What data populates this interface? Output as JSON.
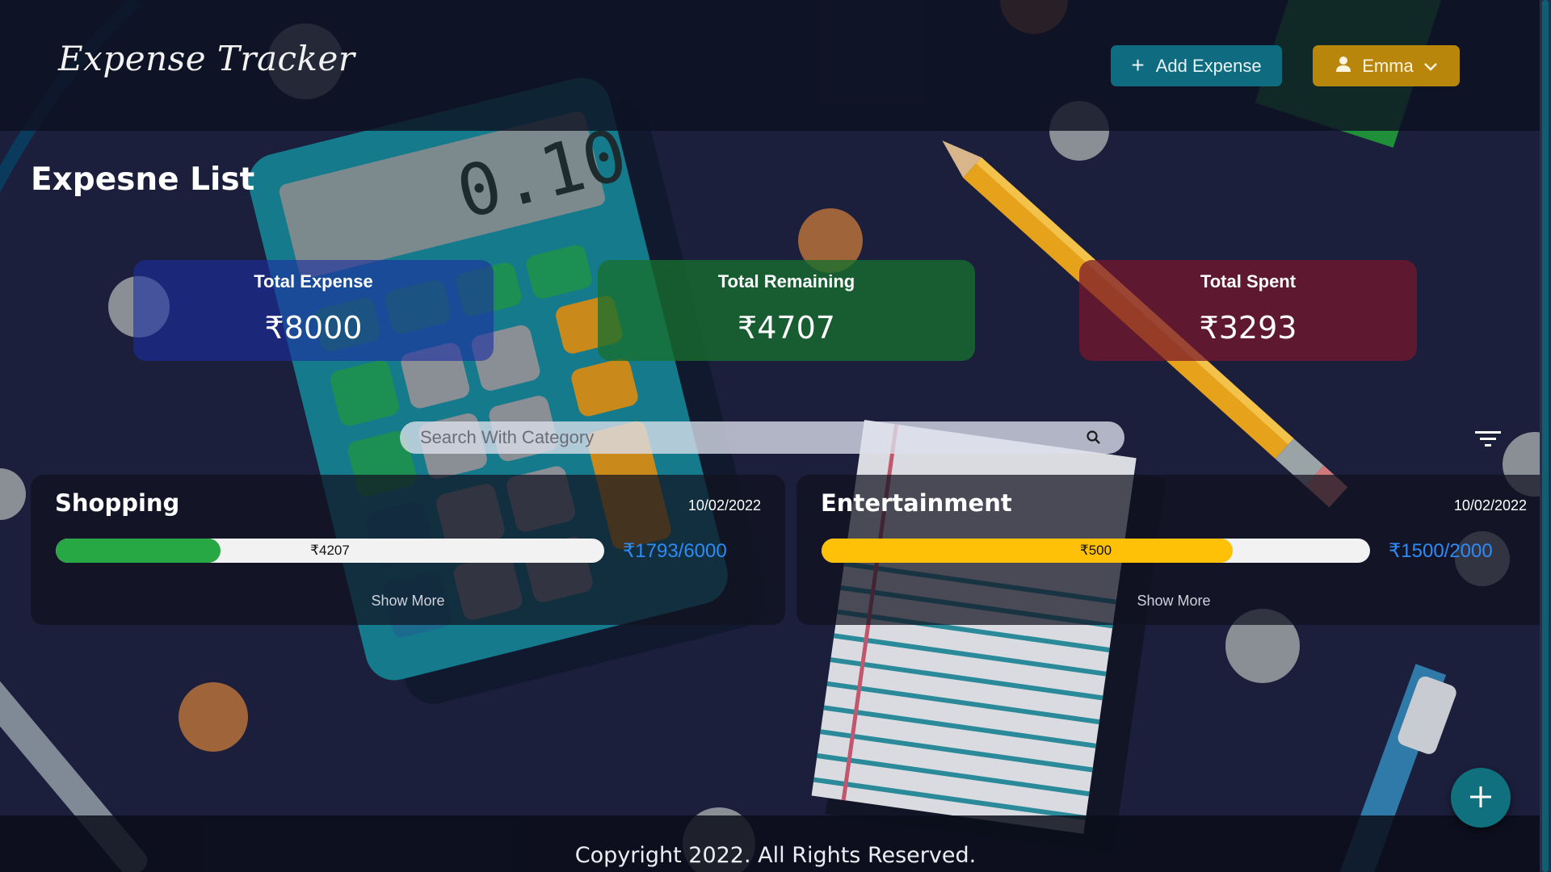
{
  "app": {
    "brand": "Expense Tracker"
  },
  "header": {
    "add_expense_label": "Add Expense",
    "user_name": "Emma"
  },
  "main": {
    "title": "Expesne List",
    "stats": [
      {
        "label": "Total Expense",
        "value": "₹8000",
        "color": "#1c2ea0"
      },
      {
        "label": "Total Remaining",
        "value": "₹4707",
        "color": "#176e2e"
      },
      {
        "label": "Total Spent",
        "value": "₹3293",
        "color": "#78162d"
      }
    ],
    "search": {
      "placeholder": "Search With Category",
      "value": ""
    },
    "categories": [
      {
        "name": "Shopping",
        "date": "10/02/2022",
        "bar_label": "₹4207",
        "amount_text": "₹1793/6000",
        "progress": 0.3,
        "bar_color": "#28a745",
        "show_more": "Show More"
      },
      {
        "name": "Entertainment",
        "date": "10/02/2022",
        "bar_label": "₹500",
        "amount_text": "₹1500/2000",
        "progress": 0.75,
        "bar_color": "#ffc107",
        "show_more": "Show More"
      }
    ]
  },
  "icons": {
    "add": "plus-icon",
    "user": "user-icon",
    "dropdown": "chevron-down-icon",
    "search": "search-icon",
    "filter": "filter-icon",
    "fab": "plus-icon"
  },
  "footer": {
    "text": "Copyright 2022. All Rights Reserved."
  }
}
